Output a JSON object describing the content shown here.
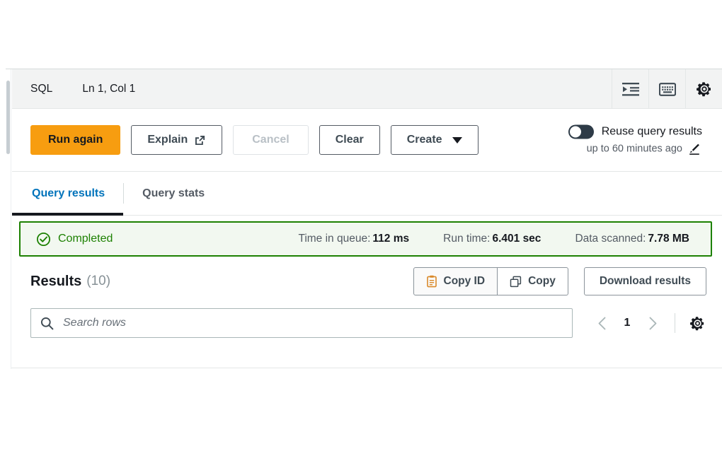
{
  "editor_bar": {
    "language_label": "SQL",
    "cursor_position": "Ln 1, Col 1",
    "icons": {
      "format_indent": "format-indent-icon",
      "keyboard": "keyboard-shortcuts-icon",
      "settings": "gear-icon"
    }
  },
  "actions": {
    "run_again": "Run again",
    "explain": "Explain",
    "explain_icon": "external-link-icon",
    "cancel": "Cancel",
    "clear": "Clear",
    "create": "Create",
    "create_caret": "caret-down-icon"
  },
  "reuse": {
    "label": "Reuse query results",
    "sub_label": "up to 60 minutes ago",
    "edit_icon": "pencil-edit-icon",
    "toggle_state": "off"
  },
  "tabs": [
    {
      "label": "Query results",
      "active": true
    },
    {
      "label": "Query stats",
      "active": false
    }
  ],
  "status": {
    "icon": "check-circle-icon",
    "label": "Completed",
    "color": "#1d8102",
    "background": "#f2f8f0",
    "metrics": [
      {
        "label": "Time in queue:",
        "value": "112 ms"
      },
      {
        "label": "Run time:",
        "value": "6.401 sec"
      },
      {
        "label": "Data scanned:",
        "value": "7.78 MB"
      }
    ]
  },
  "results": {
    "title": "Results",
    "count": "(10)",
    "copy_id_label": "Copy ID",
    "copy_id_icon": "clipboard-icon",
    "copy_label": "Copy",
    "copy_icon": "copy-duplicate-icon",
    "download_label": "Download results"
  },
  "search": {
    "placeholder": "Search rows",
    "value": "",
    "icon": "search-icon"
  },
  "pagination": {
    "prev_icon": "chevron-left-icon",
    "current_page": "1",
    "next_icon": "chevron-right-icon",
    "settings_icon": "gear-icon"
  },
  "colors": {
    "primary_orange": "#f79d10",
    "link_blue": "#0073bb",
    "success_green": "#1d8102",
    "text_dark": "#16191f",
    "text_muted": "#545b64"
  }
}
